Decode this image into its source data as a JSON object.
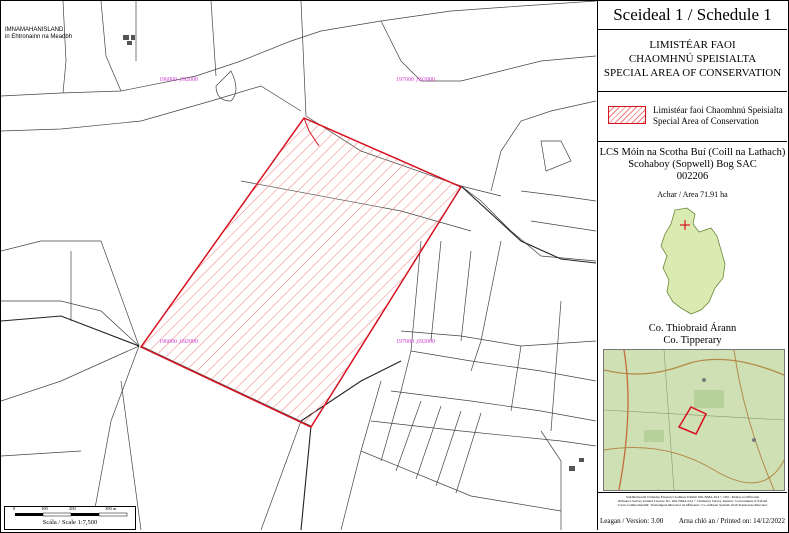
{
  "header": {
    "title": "Sceideal 1 / Schedule 1"
  },
  "designation": {
    "line1": "LIMISTÉAR FAOI",
    "line2": "CHAOMHNÚ SPEISIALTA",
    "line3": "SPECIAL AREA OF CONSERVATION"
  },
  "legend": {
    "label_irish": "Limistéar faoi Chaomhnú Speisialta",
    "label_english": "Special Area of Conservation",
    "swatch_color": "#d8101e"
  },
  "site": {
    "name_irish": "LCS Móin na Scotha Buí (Coill na Lathach)",
    "name_english": "Scohaboy (Sopwell) Bog SAC",
    "code": "002206",
    "area": "Achar / Area 71.91 ha"
  },
  "county": {
    "irish": "Co. Thiobraid Árann",
    "english": "Co. Tipperary",
    "fill_color": "#d9ebb0"
  },
  "credits": {
    "line1": "Suirbhéireacht Ordanáis Éireann Ceadúnas Uimhir OSi-NMA-014 © OSi / Rialtas na hÉireann",
    "line2": "Ordnance Survey Ireland Licence No. OSi-NMA-014 © Ordnance Survey Ireland / Government of Ireland",
    "line3": "Córas Comhordanáidí: Trasteilgean Mercator na hÉireann / Co-ordinate System: Irish Transverse Mercator"
  },
  "footer": {
    "version": "Leagan / Version: 3.00",
    "printed": "Arna chló an / Printed on: 14/12/2022"
  },
  "scale": {
    "label": "Scála / Scale 1:7,500",
    "ticks": [
      "0",
      "100",
      "200",
      "300 m"
    ]
  },
  "map": {
    "place_line1": "IMNAMAHANISLAND",
    "place_line2": "in Ehtronainn na Meadbh",
    "grid_labels": [
      "196000 ,692000",
      "197000 ,692000",
      "196000 ,692000",
      "197000 ,692000"
    ],
    "sac_color": "#d8101e",
    "grid_color": "#d23ad2"
  }
}
